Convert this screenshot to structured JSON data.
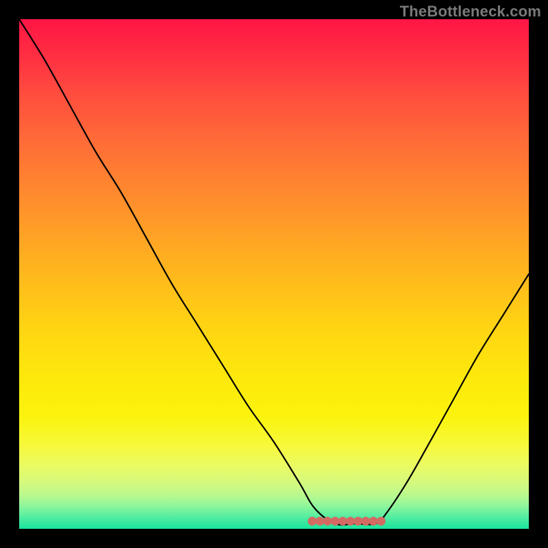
{
  "watermark": "TheBottleneck.com",
  "colors": {
    "frame": "#000000",
    "watermark_text": "#7a7a7a",
    "curve": "#000000",
    "dot": "#d36a63"
  },
  "chart_data": {
    "type": "line",
    "title": "",
    "xlabel": "",
    "ylabel": "",
    "xlim": [
      0,
      1
    ],
    "ylim": [
      0,
      1
    ],
    "series": [
      {
        "name": "bottleneck-curve",
        "x": [
          0.0,
          0.05,
          0.1,
          0.15,
          0.2,
          0.25,
          0.3,
          0.35,
          0.4,
          0.45,
          0.5,
          0.55,
          0.58,
          0.62,
          0.66,
          0.7,
          0.72,
          0.76,
          0.8,
          0.85,
          0.9,
          0.95,
          1.0
        ],
        "y": [
          1.0,
          0.92,
          0.83,
          0.74,
          0.66,
          0.57,
          0.48,
          0.4,
          0.32,
          0.24,
          0.17,
          0.09,
          0.04,
          0.01,
          0.01,
          0.01,
          0.03,
          0.09,
          0.16,
          0.25,
          0.34,
          0.42,
          0.5
        ]
      }
    ],
    "annotations": [
      {
        "name": "valley-dots",
        "x": [
          0.575,
          0.59,
          0.605,
          0.62,
          0.635,
          0.65,
          0.665,
          0.68,
          0.695,
          0.71
        ],
        "y": [
          0.015,
          0.015,
          0.015,
          0.015,
          0.015,
          0.015,
          0.015,
          0.015,
          0.015,
          0.015
        ]
      }
    ]
  }
}
